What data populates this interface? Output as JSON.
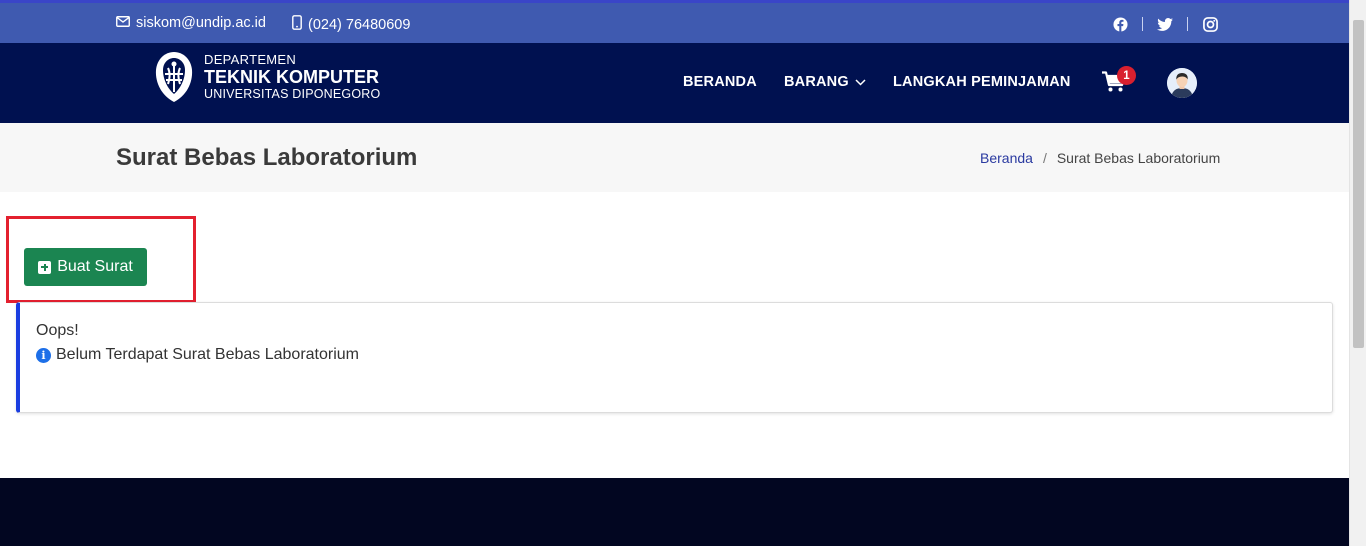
{
  "topbar": {
    "email": "siskom@undip.ac.id",
    "phone": "(024) 76480609",
    "socials": [
      "facebook-icon",
      "twitter-icon",
      "instagram-icon"
    ]
  },
  "brand": {
    "line1": "DEPARTEMEN",
    "line2": "TEKNIK KOMPUTER",
    "line3": "UNIVERSITAS DIPONEGORO"
  },
  "nav": {
    "beranda": "BERANDA",
    "barang": "BARANG",
    "langkah": "LANGKAH PEMINJAMAN",
    "cart_count": "1"
  },
  "page": {
    "title": "Surat Bebas Laboratorium"
  },
  "breadcrumb": {
    "home": "Beranda",
    "separator": "/",
    "current": "Surat Bebas Laboratorium"
  },
  "actions": {
    "create_label": "Buat Surat"
  },
  "alert": {
    "title": "Oops!",
    "message": "Belum Terdapat Surat Bebas Laboratorium"
  },
  "colors": {
    "topbar": "#3f5ab0",
    "navbar": "#001150",
    "create_button": "#1b8551",
    "alert_accent": "#1a3de0",
    "highlight": "#e3202f",
    "badge": "#d9202f"
  }
}
